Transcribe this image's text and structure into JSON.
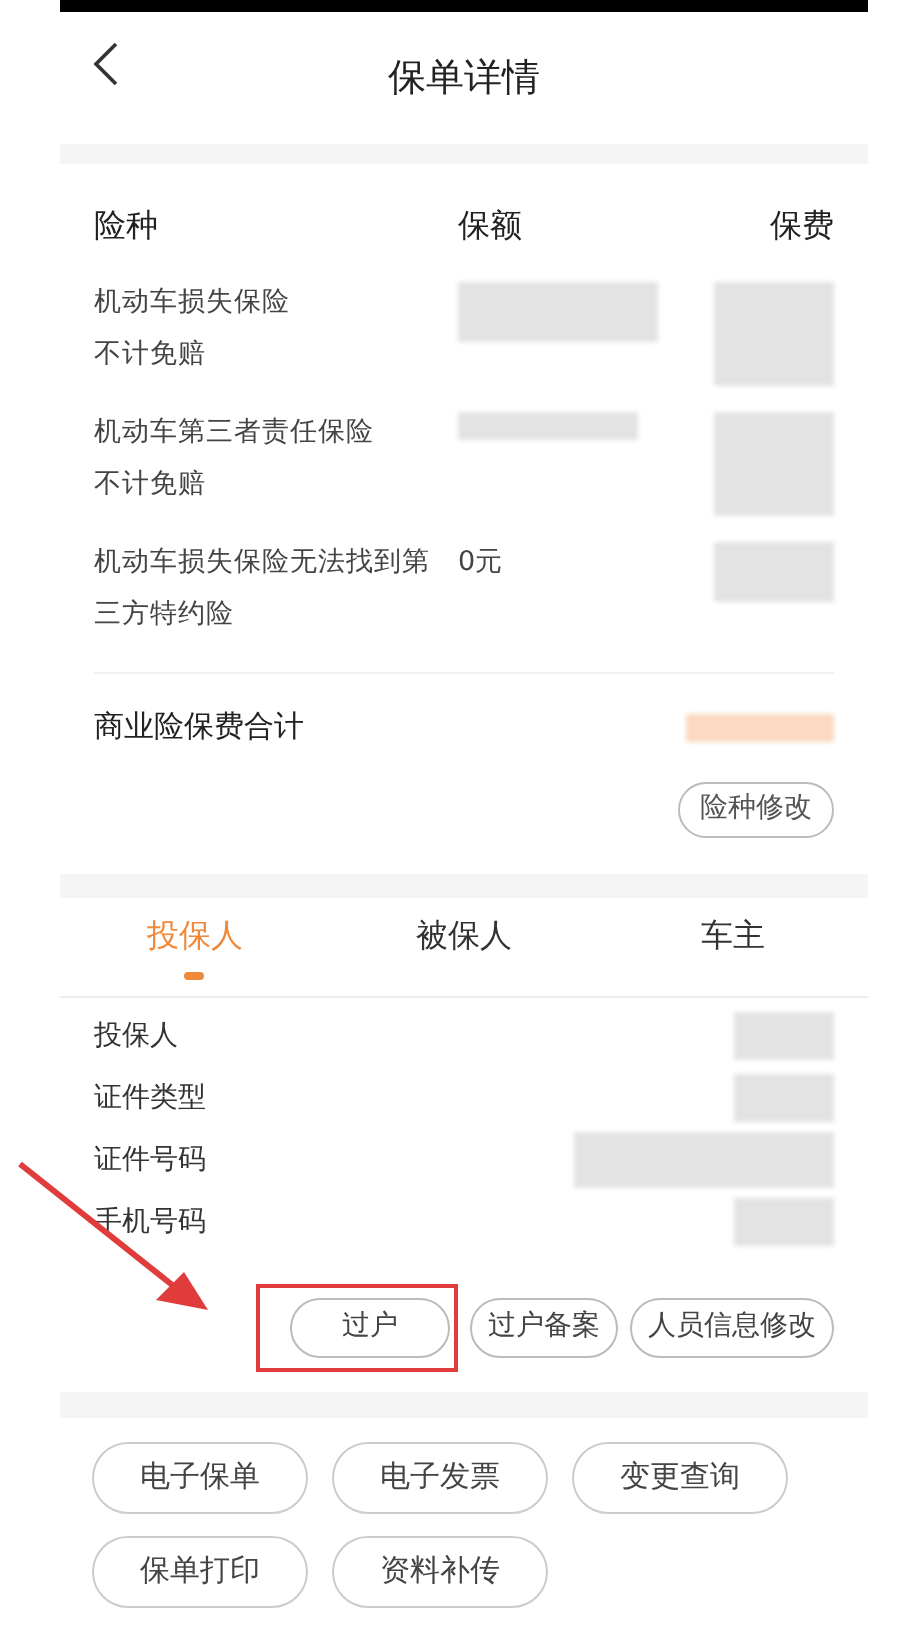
{
  "header": {
    "title": "保单详情"
  },
  "coverage_table": {
    "columns": [
      "险种",
      "保额",
      "保费"
    ],
    "rows": [
      {
        "name": "机动车损失保险",
        "sub": "不计免赔",
        "amount": ""
      },
      {
        "name": "机动车第三者责任保险",
        "sub": "不计免赔",
        "amount": ""
      },
      {
        "name": "机动车损失保险无法找到第",
        "sub": "三方特约险",
        "amount": "0元"
      }
    ]
  },
  "total": {
    "label": "商业险保费合计"
  },
  "modify_button": "险种修改",
  "tabs": [
    {
      "label": "投保人",
      "selected": true
    },
    {
      "label": "被保人",
      "selected": false
    },
    {
      "label": "车主",
      "selected": false
    }
  ],
  "person_fields": [
    "投保人",
    "证件类型",
    "证件号码",
    "手机号码"
  ],
  "person_actions": [
    {
      "label": "过户",
      "highlighted": true
    },
    {
      "label": "过户备案",
      "highlighted": false
    },
    {
      "label": "人员信息修改",
      "highlighted": false
    }
  ],
  "services": [
    "电子保单",
    "电子发票",
    "变更查询",
    "保单打印",
    "资料补传"
  ]
}
